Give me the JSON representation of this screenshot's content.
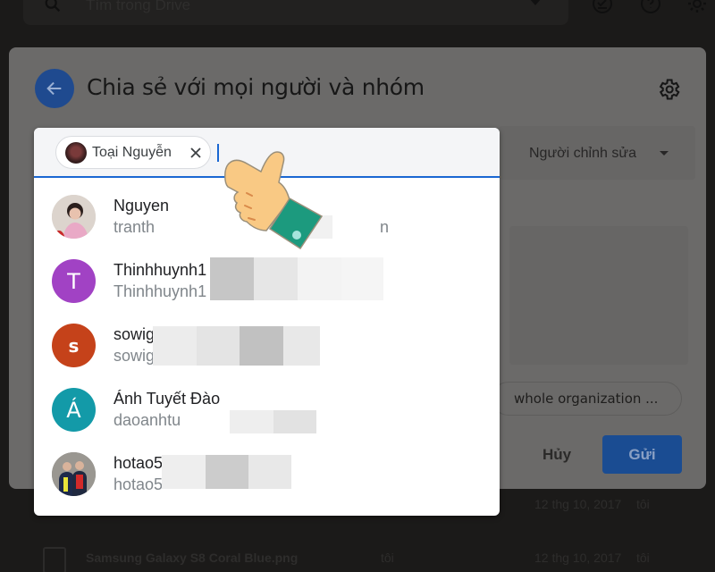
{
  "background": {
    "search_placeholder": "Tìm trong Drive",
    "rows": [
      {
        "owner": "",
        "date": "12 thg 10, 2017",
        "modified_by": "tôi"
      },
      {
        "name": "Samsung Galaxy S8 Coral Blue.png",
        "owner": "tôi",
        "date": "12 thg 10, 2017",
        "modified_by": "tôi"
      }
    ]
  },
  "dialog": {
    "title": "Chia sẻ với mọi người và nhóm",
    "role_select": "Người chỉnh sửa",
    "org_chip": "whole organization ...",
    "cancel_label": "Hủy",
    "send_label": "Gửi"
  },
  "recipient_input": {
    "chips": [
      {
        "label": "Toại Nguyễn"
      }
    ],
    "value": ""
  },
  "suggestions": [
    {
      "name": "Nguyen",
      "email": "tranth",
      "email_tail": "n",
      "avatar_type": "photo",
      "avatar_letter": ""
    },
    {
      "name": "Thinhhuynh1",
      "email": "Thinhhuynh1",
      "avatar_type": "letter",
      "avatar_letter": "T",
      "avatar_color": "#a142c4"
    },
    {
      "name": "sowig",
      "email": "sowig",
      "avatar_type": "letter",
      "avatar_letter": "s",
      "avatar_color": "#c5421a"
    },
    {
      "name": "Ánh Tuyết Đào",
      "email": "daoanhtu",
      "avatar_type": "letter",
      "avatar_letter": "Á",
      "avatar_color": "#139aa8"
    },
    {
      "name": "hotao5",
      "email": "hotao5",
      "avatar_type": "photo",
      "avatar_letter": ""
    }
  ],
  "colors": {
    "accent": "#1a67d2",
    "dim_overlay": "#1b1a19"
  }
}
